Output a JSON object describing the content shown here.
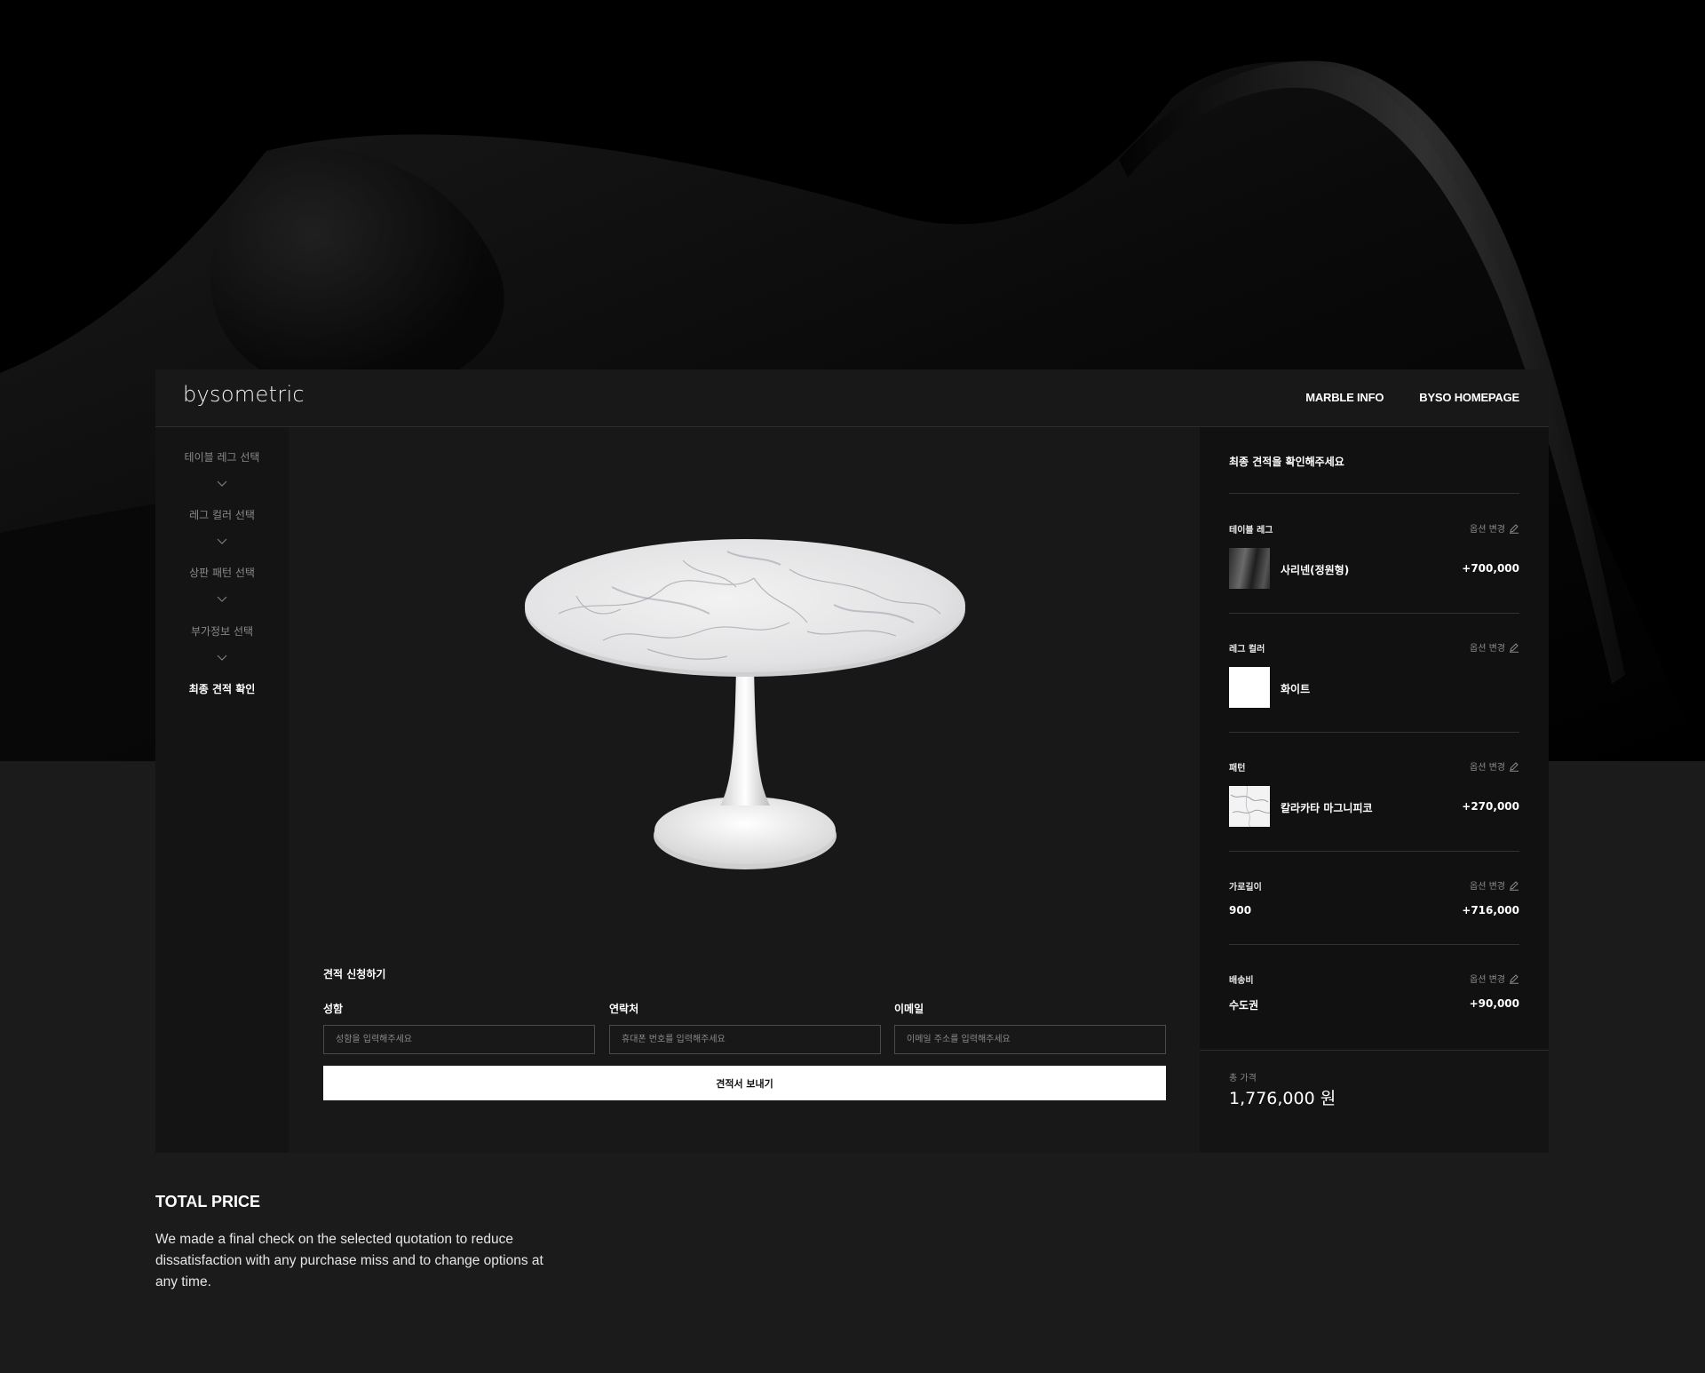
{
  "brand": {
    "logo": "bysometric"
  },
  "nav": {
    "items": [
      "MARBLE INFO",
      "BYSO HOMEPAGE"
    ]
  },
  "steps": [
    {
      "label": "테이블 레그 선택"
    },
    {
      "label": "레그 컬러 선택"
    },
    {
      "label": "상판 패턴 선택"
    },
    {
      "label": "부가정보 선택"
    },
    {
      "label": "최종 견적 확인",
      "active": true
    }
  ],
  "form": {
    "title": "견적 신청하기",
    "fields": [
      {
        "label": "성함",
        "placeholder": "성함을 입력해주세요"
      },
      {
        "label": "연락처",
        "placeholder": "휴대폰 번호를 입력해주세요"
      },
      {
        "label": "이메일",
        "placeholder": "이메일 주소를 입력해주세요"
      }
    ],
    "submit_label": "견적서 보내기"
  },
  "summary": {
    "title": "최종 견적을 확인해주세요",
    "edit_label": "옵션 변경",
    "sections": [
      {
        "label": "테이블 레그",
        "value": "사리넨(정원형)",
        "price": "+700,000",
        "swatch": "dark-metal"
      },
      {
        "label": "레그 컬러",
        "value": "화이트",
        "price": "",
        "swatch": "white"
      },
      {
        "label": "패턴",
        "value": "칼라카타 마그니피코",
        "price": "+270,000",
        "swatch": "marble"
      },
      {
        "label": "가로길이",
        "value": "900",
        "price": "+716,000"
      },
      {
        "label": "배송비",
        "value": "수도권",
        "price": "+90,000"
      }
    ],
    "total_label": "총 가격",
    "total_value": "1,776,000 원"
  },
  "caption": {
    "title": "TOTAL PRICE",
    "text": "We made a final check on the selected quotation to reduce dissatisfaction with any purchase miss and to change options at any time."
  },
  "colors": {
    "page_bg": "#1b1b1b",
    "panel_bg": "#181818",
    "summary_bg": "#111111",
    "accent": "#ffffff"
  }
}
